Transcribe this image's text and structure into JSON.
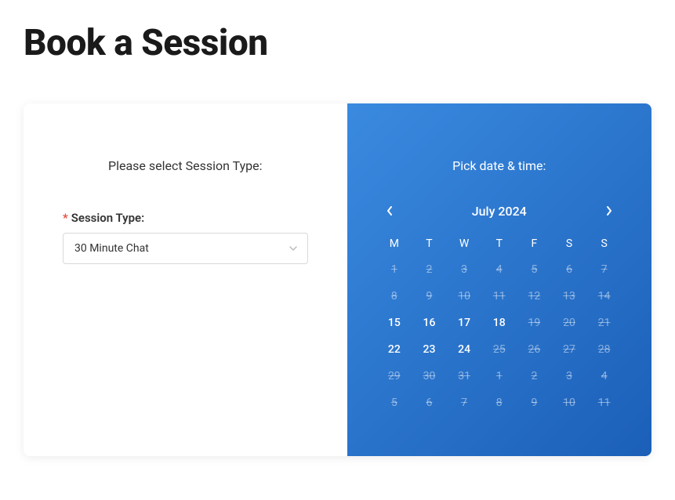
{
  "page": {
    "title": "Book a Session"
  },
  "left": {
    "prompt": "Please select Session Type:",
    "field_label": "Session Type:",
    "required_marker": "*",
    "selected_value": "30 Minute Chat"
  },
  "right": {
    "prompt": "Pick date & time:"
  },
  "calendar": {
    "month_label": "July 2024",
    "dow": [
      "M",
      "T",
      "W",
      "T",
      "F",
      "S",
      "S"
    ],
    "weeks": [
      [
        {
          "d": "1",
          "enabled": false
        },
        {
          "d": "2",
          "enabled": false
        },
        {
          "d": "3",
          "enabled": false
        },
        {
          "d": "4",
          "enabled": false
        },
        {
          "d": "5",
          "enabled": false
        },
        {
          "d": "6",
          "enabled": false
        },
        {
          "d": "7",
          "enabled": false
        }
      ],
      [
        {
          "d": "8",
          "enabled": false
        },
        {
          "d": "9",
          "enabled": false
        },
        {
          "d": "10",
          "enabled": false
        },
        {
          "d": "11",
          "enabled": false
        },
        {
          "d": "12",
          "enabled": false
        },
        {
          "d": "13",
          "enabled": false
        },
        {
          "d": "14",
          "enabled": false
        }
      ],
      [
        {
          "d": "15",
          "enabled": true
        },
        {
          "d": "16",
          "enabled": true
        },
        {
          "d": "17",
          "enabled": true
        },
        {
          "d": "18",
          "enabled": true
        },
        {
          "d": "19",
          "enabled": false
        },
        {
          "d": "20",
          "enabled": false
        },
        {
          "d": "21",
          "enabled": false
        }
      ],
      [
        {
          "d": "22",
          "enabled": true
        },
        {
          "d": "23",
          "enabled": true
        },
        {
          "d": "24",
          "enabled": true
        },
        {
          "d": "25",
          "enabled": false
        },
        {
          "d": "26",
          "enabled": false
        },
        {
          "d": "27",
          "enabled": false
        },
        {
          "d": "28",
          "enabled": false
        }
      ],
      [
        {
          "d": "29",
          "enabled": false
        },
        {
          "d": "30",
          "enabled": false
        },
        {
          "d": "31",
          "enabled": false
        },
        {
          "d": "1",
          "enabled": false
        },
        {
          "d": "2",
          "enabled": false
        },
        {
          "d": "3",
          "enabled": false
        },
        {
          "d": "4",
          "enabled": false
        }
      ],
      [
        {
          "d": "5",
          "enabled": false
        },
        {
          "d": "6",
          "enabled": false
        },
        {
          "d": "7",
          "enabled": false
        },
        {
          "d": "8",
          "enabled": false
        },
        {
          "d": "9",
          "enabled": false
        },
        {
          "d": "10",
          "enabled": false
        },
        {
          "d": "11",
          "enabled": false
        }
      ]
    ]
  }
}
